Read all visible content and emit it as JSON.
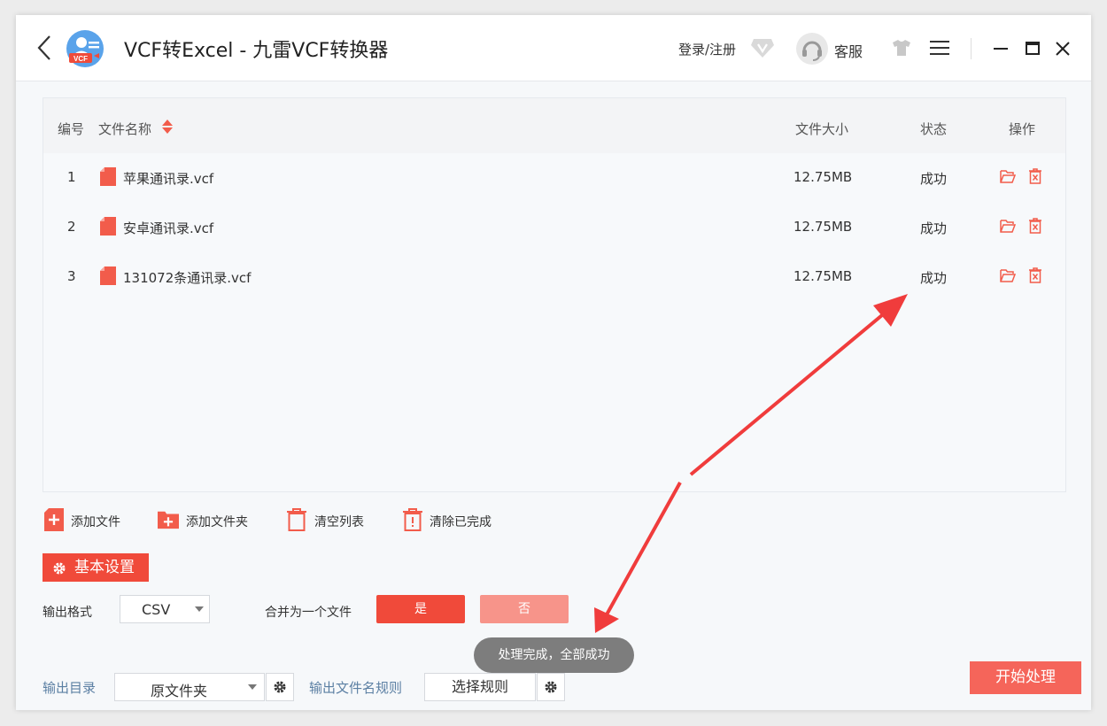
{
  "window": {
    "title": "VCF转Excel - 九雷VCF转换器",
    "logo_text": "VCF",
    "login_label": "登录/注册",
    "service_label": "客服"
  },
  "table": {
    "headers": {
      "index": "编号",
      "filename": "文件名称",
      "size": "文件大小",
      "status": "状态",
      "actions": "操作"
    },
    "rows": [
      {
        "index": "1",
        "filename": "苹果通讯录.vcf",
        "size": "12.75MB",
        "status": "成功"
      },
      {
        "index": "2",
        "filename": "安卓通讯录.vcf",
        "size": "12.75MB",
        "status": "成功"
      },
      {
        "index": "3",
        "filename": "131072条通讯录.vcf",
        "size": "12.75MB",
        "status": "成功"
      }
    ]
  },
  "toolbar": {
    "add_file": "添加文件",
    "add_folder": "添加文件夹",
    "clear_list": "清空列表",
    "clear_done": "清除已完成"
  },
  "settings": {
    "tab_label": "基本设置",
    "output_format_label": "输出格式",
    "output_format_value": "CSV",
    "merge_label": "合并为一个文件",
    "merge_yes": "是",
    "merge_no": "否",
    "output_dir_label": "输出目录",
    "output_dir_value": "原文件夹",
    "filename_rule_label": "输出文件名规则",
    "select_rule_button": "选择规则"
  },
  "toast": "处理完成，全部成功",
  "start_button": "开始处理",
  "colors": {
    "accent": "#f04a3a",
    "accent_light": "#f7948a",
    "start_button": "#f5655a",
    "annotation_arrow": "#f03c3c",
    "blue_label": "#5b7fa3"
  }
}
